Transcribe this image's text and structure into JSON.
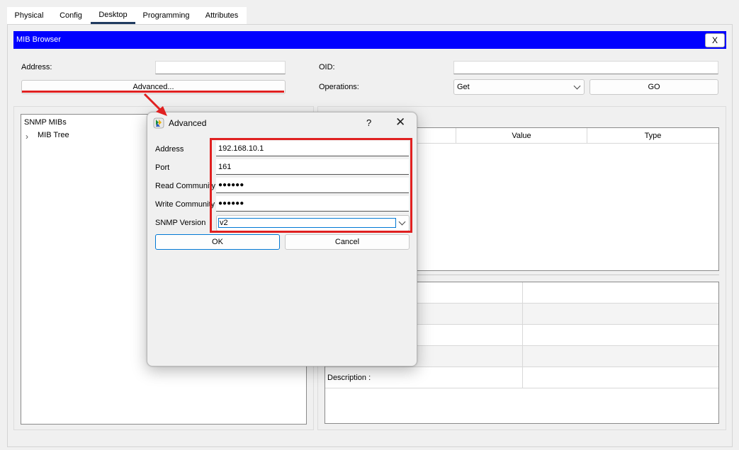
{
  "tabs": [
    "Physical",
    "Config",
    "Desktop",
    "Programming",
    "Attributes"
  ],
  "active_tab": "Desktop",
  "window": {
    "title": "MIB Browser",
    "close_label": "X"
  },
  "address": {
    "label": "Address:",
    "value": ""
  },
  "oid": {
    "label": "OID:",
    "value": ""
  },
  "advanced_button": "Advanced...",
  "operations": {
    "label": "Operations:",
    "selected": "Get"
  },
  "go_button": "GO",
  "mib_tree": {
    "header": "SNMP MIBs",
    "root": "MIB Tree"
  },
  "result_table": {
    "columns": [
      "",
      "Value",
      "Type"
    ]
  },
  "details": {
    "rows": [
      "",
      "",
      "",
      "",
      "Description :"
    ]
  },
  "dialog": {
    "title": "Advanced",
    "help": "?",
    "fields": [
      {
        "label": "Address",
        "value": "192.168.10.1"
      },
      {
        "label": "Port",
        "value": "161"
      },
      {
        "label": "Read Community",
        "value": "●●●●●●"
      },
      {
        "label": "Write Community",
        "value": "●●●●●●"
      }
    ],
    "version": {
      "label": "SNMP Version",
      "selected": "v2"
    },
    "ok": "OK",
    "cancel": "Cancel"
  },
  "annotation_color": "#e02020"
}
